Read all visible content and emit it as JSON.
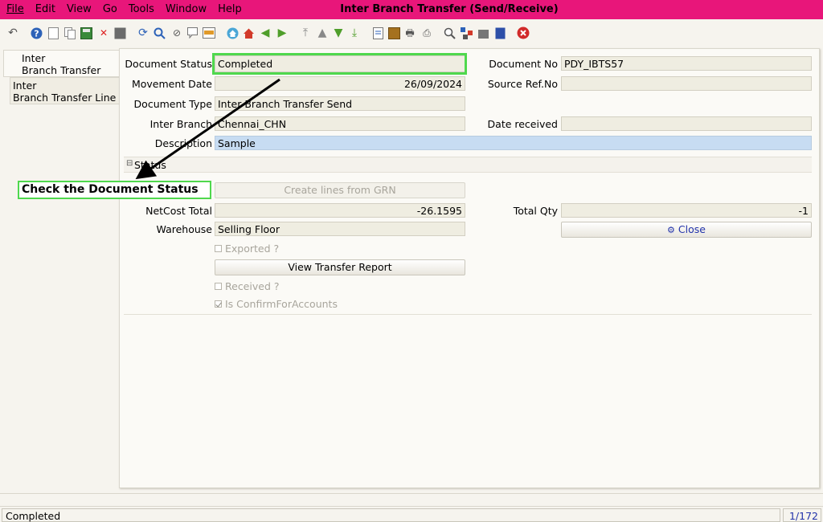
{
  "window": {
    "title": "Inter Branch Transfer (Send/Receive)"
  },
  "menu": [
    "File",
    "Edit",
    "View",
    "Go",
    "Tools",
    "Window",
    "Help"
  ],
  "toolbar_icons": [
    "undo-icon",
    "help-icon",
    "new-icon",
    "copy-icon",
    "save-icon",
    "delete-icon",
    "grid-icon",
    "refresh-icon",
    "find-icon",
    "attachment-icon",
    "chat-icon",
    "history-icon",
    "home-icon",
    "home-red-icon",
    "back-icon",
    "forward-icon",
    "first-icon",
    "previous-icon",
    "next-icon",
    "last-icon",
    "report-icon",
    "archive-icon",
    "print-preview-icon",
    "print-icon",
    "zoom-icon",
    "workflow-icon",
    "product-icon",
    "note-icon",
    "exit-icon"
  ],
  "tabs": {
    "header_line1": "Inter",
    "header_line2": "Branch Transfer",
    "line_line1": "Inter",
    "line_line2": "Branch Transfer Line"
  },
  "form": {
    "document_status_label": "Document Status",
    "document_status": "Completed",
    "document_no_label": "Document No",
    "document_no": "PDY_IBTS57",
    "movement_date_label": "Movement Date",
    "movement_date": "26/09/2024",
    "source_ref_label": "Source Ref.No",
    "source_ref": "",
    "document_type_label": "Document Type",
    "document_type": "Inter Branch Transfer Send",
    "inter_branch_label": "Inter Branch",
    "inter_branch": "Chennai_CHN",
    "date_received_label": "Date received",
    "date_received": "",
    "description_label": "Description",
    "description": "Sample",
    "status_group": "Status",
    "create_lines_button": "Create lines from GRN",
    "netcost_label": "NetCost Total",
    "netcost": "-26.1595",
    "total_qty_label": "Total Qty",
    "total_qty": "-1",
    "warehouse_label": "Warehouse",
    "warehouse": "Selling Floor",
    "close_button": "Close",
    "exported_label": "Exported ?",
    "view_report_button": "View Transfer Report",
    "received_label": "Received ?",
    "confirm_label": "Is ConfirmForAccounts"
  },
  "annotation": {
    "text": "Check the Document Status",
    "color": "#4fd84d"
  },
  "statusbar": {
    "text": "Completed",
    "page": "1/172"
  },
  "colors": {
    "titlebar": "#e8167a",
    "field": "#efede1",
    "editable_field": "#c7dcf2"
  }
}
